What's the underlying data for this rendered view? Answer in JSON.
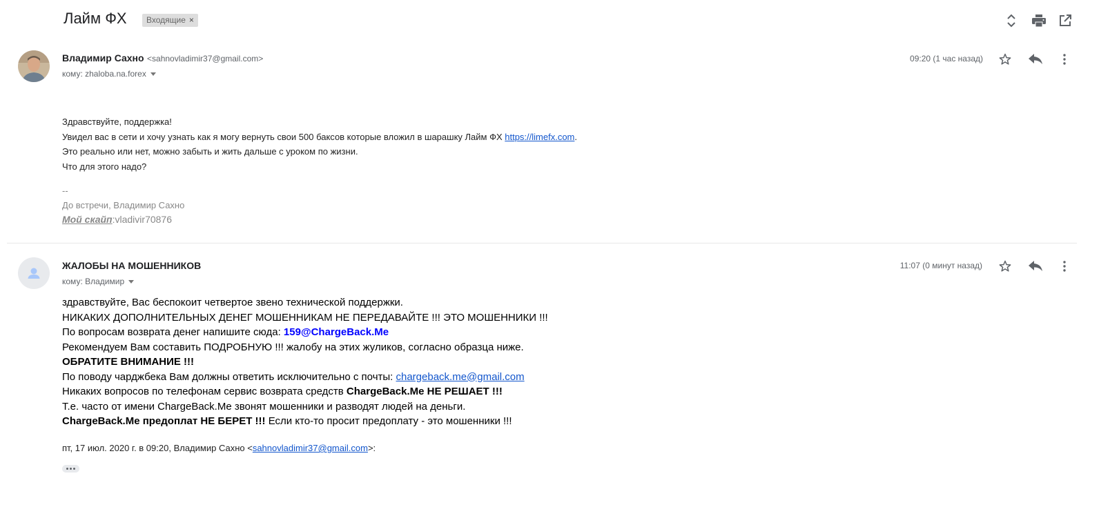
{
  "thread": {
    "subject": "Лайм ФХ",
    "label": "Входящие",
    "label_remove": "×"
  },
  "header_icons": [
    "expand-collapse-icon",
    "print-icon",
    "open-in-new-window-icon"
  ],
  "message1": {
    "sender_name": "Владимир Сахно",
    "sender_email": "<sahnovladimir37@gmail.com>",
    "to": "кому: zhaloba.na.forex",
    "time": "09:20 (1 час назад)",
    "body": {
      "line1": "Здравствуйте, поддержка!",
      "line2_text": "Увидел вас в сети и хочу узнать как я могу вернуть свои 500 баксов которые вложил в шарашку Лайм ФХ ",
      "line2_link": "https://limefx.com",
      "line2_end": ".",
      "line3": "Это реально или нет, можно забыть и жить дальше с уроком по жизни.",
      "line4": "Что для этого надо?"
    },
    "signature": {
      "dash": "--",
      "farewell": "До встречи, Владимир Сахно",
      "skype_label": "Мой скайп",
      "skype_value": ":vladivir70876"
    }
  },
  "message2": {
    "sender_name": "ЖАЛОБЫ НА МОШЕННИКОВ",
    "to": "кому: Владимир",
    "time": "11:07 (0 минут назад)",
    "body": {
      "l1": "здравствуйте, Вас беспокоит четвертое звено технической поддержки.",
      "l2": "НИКАКИХ ДОПОЛНИТЕЛЬНЫХ ДЕНЕГ МОШЕННИКАМ НЕ ПЕРЕДАВАЙТЕ !!! ЭТО МОШЕННИКИ !!!",
      "l3_text": "По вопросам возврата денег напишите сюда: ",
      "l3_email": "159@ChargeBack.Me",
      "l4": "Рекомендуем Вам составить ПОДРОБНУЮ !!! жалобу на этих жуликов, согласно образца ниже.",
      "l5": "ОБРАТИТЕ ВНИМАНИЕ !!!",
      "l6_text": "По поводу чарджбека Вам должны ответить исключительно с почты: ",
      "l6_link": "chargeback.me@gmail.com",
      "l7_text": "Никаких вопросов по телефонам сервис возврата средств ",
      "l7_bold": "ChargeBack.Me НЕ РЕШАЕТ !!!",
      "l8": "Т.е. часто от имени ChargeBack.Me звонят мошенники и разводят людей на деньги.",
      "l9_bold": "ChargeBack.Me предоплат НЕ БЕРЕТ !!!",
      "l9_text": " Если кто-то просит предоплату - это мошенники !!!"
    },
    "quote": {
      "prefix": "пт, 17 июл. 2020 г. в 09:20, Владимир Сахно <",
      "email": "sahnovladimir37@gmail.com",
      "suffix": ">:"
    }
  },
  "colors": {
    "link": "#1155cc",
    "accent_email": "#0000ff",
    "label_chip": "#dddddd",
    "meta_gray": "#5f6368"
  }
}
